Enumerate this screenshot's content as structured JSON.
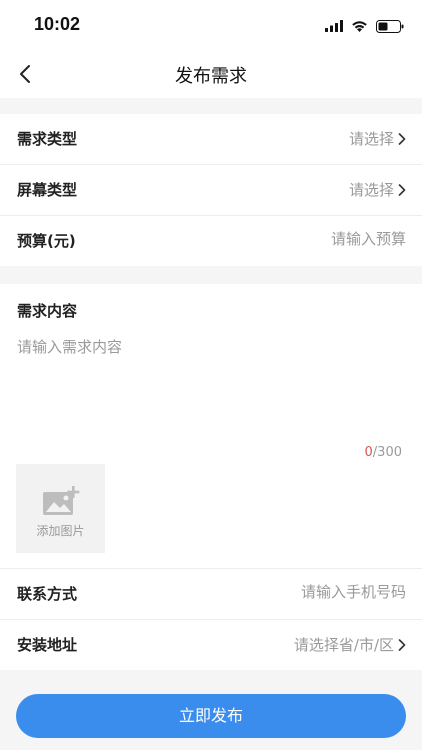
{
  "status_bar": {
    "time": "10:02"
  },
  "nav": {
    "title": "发布需求"
  },
  "form_top": {
    "rows": [
      {
        "label": "需求类型",
        "value": "请选择"
      },
      {
        "label": "屏幕类型",
        "value": "请选择"
      },
      {
        "label": "预算(元)",
        "placeholder": "请输入预算"
      }
    ]
  },
  "content": {
    "title": "需求内容",
    "placeholder": "请输入需求内容",
    "count_current": "0",
    "count_max": "/300",
    "add_image_label": "添加图片"
  },
  "form_bottom": {
    "rows": [
      {
        "label": "联系方式",
        "placeholder": "请输入手机号码"
      },
      {
        "label": "安装地址",
        "value": "请选择省/市/区"
      }
    ]
  },
  "submit_label": "立即发布",
  "colors": {
    "primary": "#3b8ded",
    "counter_current": "#d9534f",
    "placeholder": "#9a9a9a"
  }
}
